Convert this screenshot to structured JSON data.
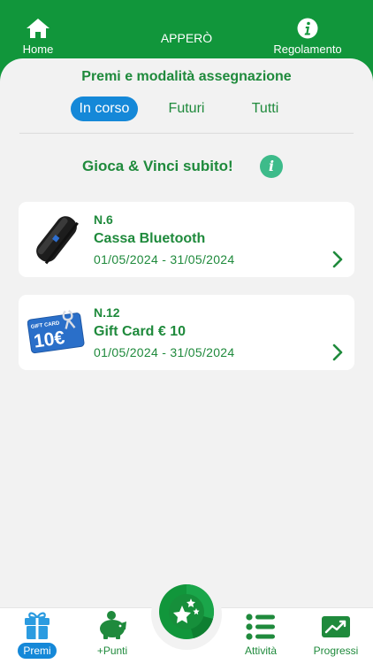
{
  "header": {
    "home_label": "Home",
    "title": "APPERÒ",
    "rules_label": "Regolamento"
  },
  "sheet": {
    "title": "Premi e modalità assegnazione",
    "tabs": [
      {
        "label": "In corso",
        "active": true
      },
      {
        "label": "Futuri",
        "active": false
      },
      {
        "label": "Tutti",
        "active": false
      }
    ],
    "section_title": "Gioca & Vinci subito!"
  },
  "prizes": [
    {
      "number": "N.6",
      "name": "Cassa Bluetooth",
      "dates": "01/05/2024 - 31/05/2024",
      "image_icon": "bluetooth-speaker"
    },
    {
      "number": "N.12",
      "name": "Gift Card € 10",
      "dates": "01/05/2024 - 31/05/2024",
      "image_icon": "gift-card",
      "card_caption": "GIFT CARD",
      "card_value": "10€"
    }
  ],
  "tabbar": {
    "premi": "Premi",
    "punti": "+Punti",
    "attivita": "Attività",
    "progressi": "Progressi",
    "active": "Premi"
  },
  "colors": {
    "brand_green": "#11963b",
    "text_green": "#1f8a3c",
    "accent_blue": "#1588d8",
    "info_teal": "#3dbb8a"
  }
}
